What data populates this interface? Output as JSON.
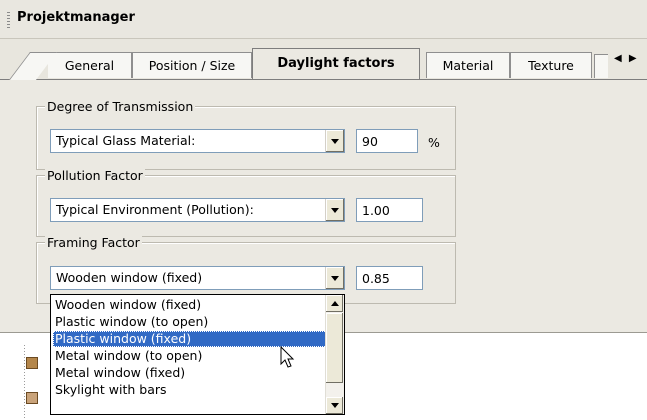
{
  "window": {
    "title": "Projektmanager"
  },
  "tabs": [
    {
      "label": "General"
    },
    {
      "label": "Position / Size"
    },
    {
      "label": "Daylight factors",
      "active": true
    },
    {
      "label": "Material"
    },
    {
      "label": "Texture"
    }
  ],
  "tab_nav": {
    "glyphs": "◀ ▶"
  },
  "groups": {
    "transmission": {
      "legend": "Degree of Transmission",
      "select_value": "Typical Glass Material:",
      "number_value": "90",
      "unit": "%"
    },
    "pollution": {
      "legend": "Pollution Factor",
      "select_value": "Typical Environment (Pollution):",
      "number_value": "1.00"
    },
    "framing": {
      "legend": "Framing Factor",
      "select_value": "Wooden window (fixed)",
      "number_value": "0.85"
    }
  },
  "dropdown": {
    "options": [
      "Wooden window (fixed)",
      "Plastic window (to open)",
      "Plastic window (fixed)",
      "Metal window (to open)",
      "Metal window (fixed)",
      "Skylight with bars"
    ],
    "selected": "Plastic window (fixed)"
  },
  "colors": {
    "selection": "#316ac5",
    "panel": "#ebe9e2",
    "field_border": "#7f9db9"
  }
}
